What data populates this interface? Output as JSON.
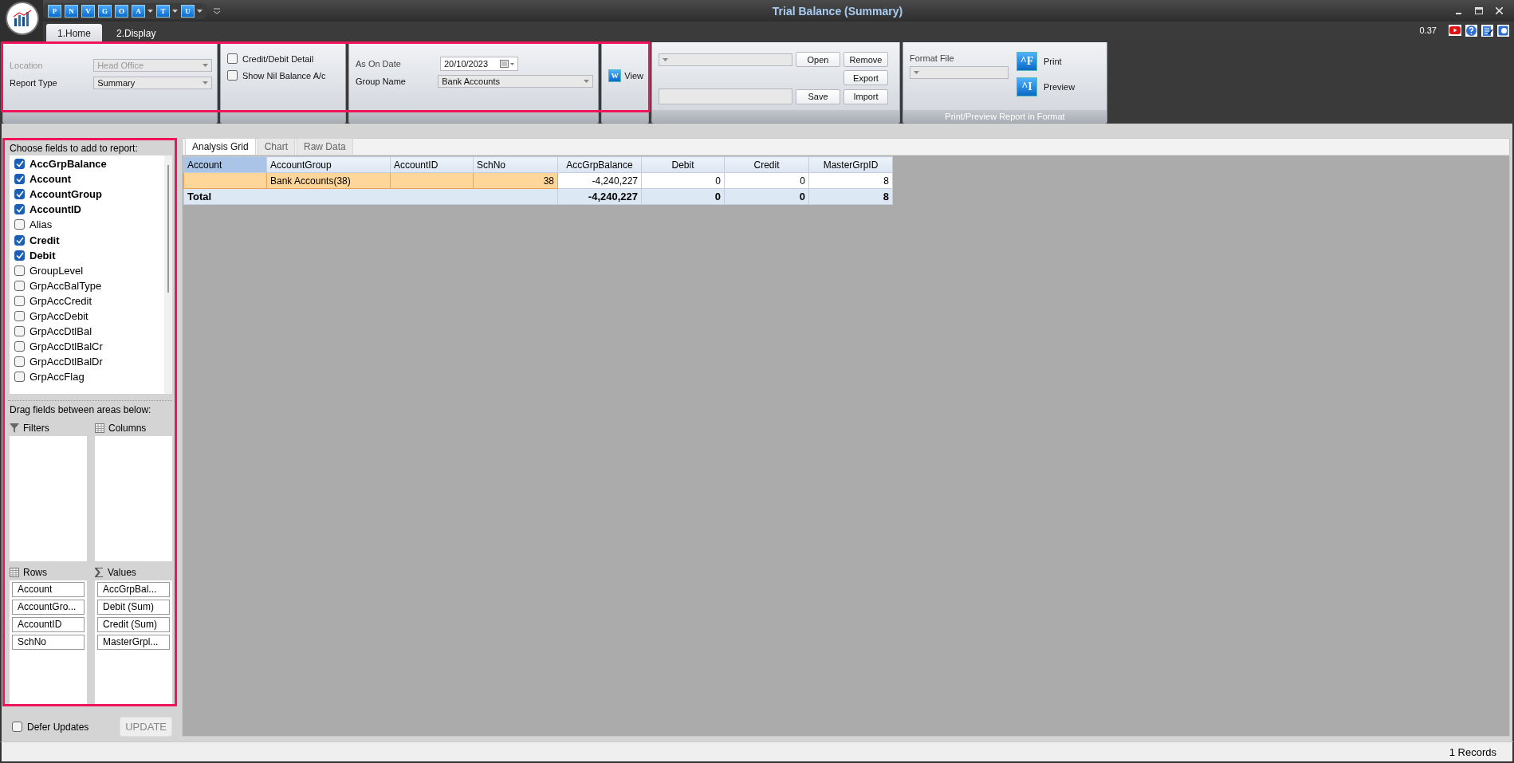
{
  "window": {
    "title": "Trial Balance (Summary)"
  },
  "quick_access": [
    {
      "letter": "P",
      "dropdown": false
    },
    {
      "letter": "N",
      "dropdown": false
    },
    {
      "letter": "V",
      "dropdown": false
    },
    {
      "letter": "G",
      "dropdown": false
    },
    {
      "letter": "O",
      "dropdown": false
    },
    {
      "letter": "A",
      "dropdown": true
    },
    {
      "letter": "T",
      "dropdown": true
    },
    {
      "letter": "U",
      "dropdown": true
    }
  ],
  "ribbon_tabs": [
    {
      "label": "1.Home",
      "selected": true
    },
    {
      "label": "2.Display",
      "selected": false
    }
  ],
  "timer": "0.37",
  "report_options": {
    "highlighted": true,
    "location": {
      "label": "Location",
      "value": "Head Office",
      "disabled": true
    },
    "report_type": {
      "label": "Report Type",
      "value": "Summary",
      "disabled": false
    },
    "checkboxes": [
      {
        "label": "Credit/Debit Detail",
        "checked": false
      },
      {
        "label": "Show Nil Balance A/c",
        "checked": false
      }
    ],
    "as_on_date": {
      "label": "As On Date",
      "value": "20/10/2023"
    },
    "group_name": {
      "label": "Group Name",
      "value": "Bank Accounts"
    },
    "view_button": {
      "icon_letter": "W",
      "label": "View"
    }
  },
  "layout_group": {
    "buttons": [
      "Open",
      "Remove",
      "Export",
      "Save",
      "Import"
    ]
  },
  "format_group": {
    "label": "Format File",
    "print": {
      "icon_text": "^F",
      "label": "Print"
    },
    "preview": {
      "icon_text": "^I",
      "label": "Preview"
    },
    "caption": "Print/Preview Report in Format"
  },
  "field_panel": {
    "highlighted": true,
    "header": "Choose fields to add to report:",
    "fields": [
      {
        "label": "AccGrpBalance",
        "checked": true
      },
      {
        "label": "Account",
        "checked": true
      },
      {
        "label": "AccountGroup",
        "checked": true
      },
      {
        "label": "AccountID",
        "checked": true
      },
      {
        "label": "Alias",
        "checked": false
      },
      {
        "label": "Credit",
        "checked": true
      },
      {
        "label": "Debit",
        "checked": true
      },
      {
        "label": "GroupLevel",
        "checked": false
      },
      {
        "label": "GrpAccBalType",
        "checked": false
      },
      {
        "label": "GrpAccCredit",
        "checked": false
      },
      {
        "label": "GrpAccDebit",
        "checked": false
      },
      {
        "label": "GrpAccDtlBal",
        "checked": false
      },
      {
        "label": "GrpAccDtlBalCr",
        "checked": false
      },
      {
        "label": "GrpAccDtlBalDr",
        "checked": false
      },
      {
        "label": "GrpAccFlag",
        "checked": false
      }
    ],
    "areas_header": "Drag fields between areas below:",
    "areas": [
      {
        "kind": "filters",
        "label": "Filters"
      },
      {
        "kind": "columns",
        "label": "Columns"
      },
      {
        "kind": "rows",
        "label": "Rows",
        "items": [
          "Account",
          "AccountGro...",
          "AccountID",
          "SchNo"
        ]
      },
      {
        "kind": "values",
        "label": "Values",
        "items": [
          "AccGrpBal...",
          "Debit (Sum)",
          "Credit (Sum)",
          "MasterGrpl..."
        ]
      }
    ],
    "defer_updates": {
      "label": "Defer Updates",
      "checked": false
    },
    "update_button": {
      "label": "UPDATE",
      "disabled": true
    }
  },
  "view_tabs": [
    {
      "label": "Analysis Grid",
      "selected": true
    },
    {
      "label": "Chart",
      "selected": false
    },
    {
      "label": "Raw Data",
      "selected": false
    }
  ],
  "table": {
    "columns": [
      {
        "label": "Account",
        "selected": true
      },
      {
        "label": "AccountGroup",
        "selected": false
      },
      {
        "label": "AccountID",
        "selected": false
      },
      {
        "label": "SchNo",
        "selected": false
      },
      {
        "label": "AccGrpBalance",
        "selected": false
      },
      {
        "label": "Debit",
        "selected": false
      },
      {
        "label": "Credit",
        "selected": false
      },
      {
        "label": "MasterGrpID",
        "selected": false
      }
    ],
    "rows": [
      {
        "selected": true,
        "cells": [
          null,
          "Bank Accounts(38)",
          null,
          "38",
          "-4,240,227",
          "0",
          "0",
          "8"
        ]
      }
    ],
    "total": {
      "label": "Total",
      "values": [
        "-4,240,227",
        "0",
        "0",
        "8"
      ]
    }
  },
  "status_bar": {
    "records": "1 Records"
  }
}
